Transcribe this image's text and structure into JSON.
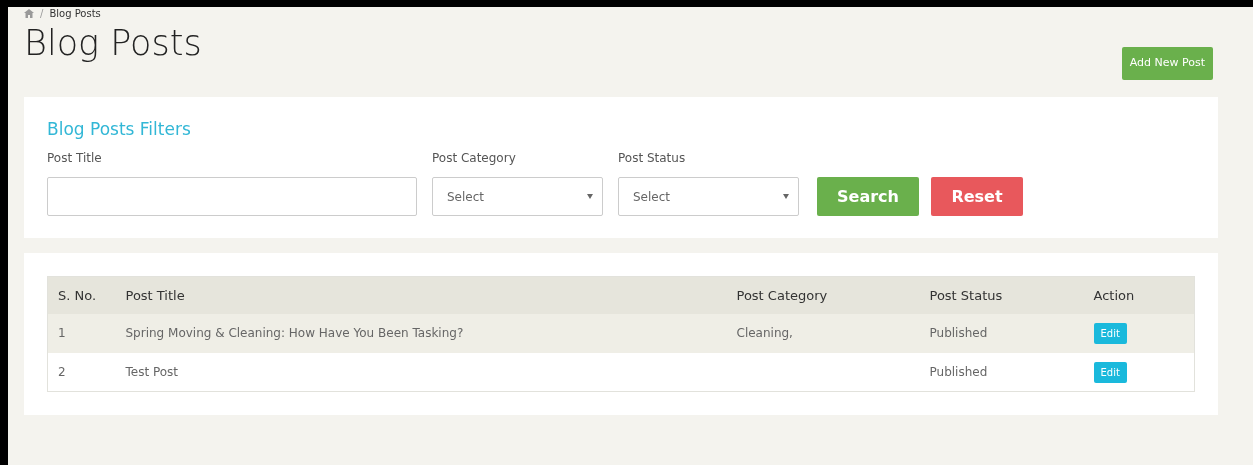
{
  "breadcrumb": {
    "separator": "/",
    "items": [
      "Blog Posts"
    ]
  },
  "page_title": "Blog Posts",
  "add_button": "Add New Post",
  "filters": {
    "title": "Blog Posts Filters",
    "fields": [
      {
        "kind": "text",
        "label": "Post Title"
      },
      {
        "kind": "select",
        "label": "Post Category",
        "value": "Select"
      },
      {
        "kind": "select",
        "label": "Post Status",
        "value": "Select"
      }
    ],
    "buttons": [
      {
        "kind": "search",
        "label": "Search"
      },
      {
        "kind": "reset",
        "label": "Reset"
      }
    ]
  },
  "table": {
    "columns": [
      "S. No.",
      "Post Title",
      "Post Category",
      "Post Status",
      "Action"
    ],
    "rows": [
      {
        "cells": [
          "1",
          "Spring Moving & Cleaning: How Have You Been Tasking?",
          "Cleaning,",
          "Published"
        ],
        "action": "Edit"
      },
      {
        "cells": [
          "2",
          "Test Post",
          "",
          "Published"
        ],
        "action": "Edit"
      }
    ]
  }
}
